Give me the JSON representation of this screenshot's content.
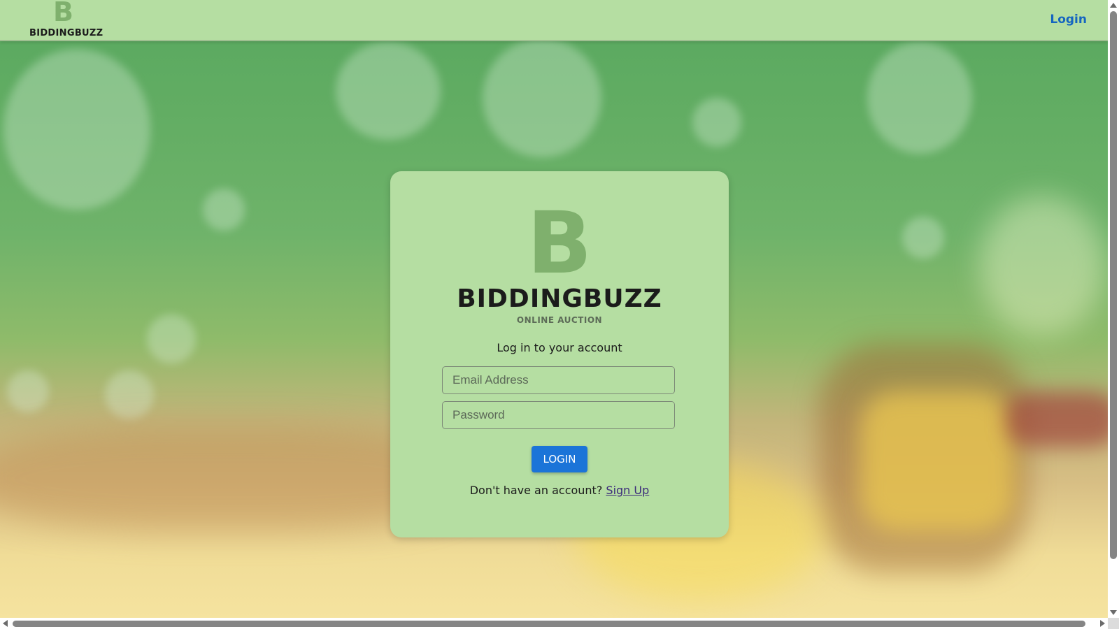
{
  "navbar": {
    "logo_letter": "B",
    "logo_wordmark": "BIDDINGBUZZ",
    "login_link": "Login"
  },
  "login_card": {
    "logo_letter": "B",
    "logo_wordmark": "BIDDINGBUZZ",
    "logo_tagline": "ONLINE AUCTION",
    "heading": "Log in to your account",
    "email_placeholder": "Email Address",
    "email_value": "",
    "password_placeholder": "Password",
    "password_value": "",
    "login_button": "LOGIN",
    "signup_prompt": "Don't have an account?",
    "signup_link": "Sign Up"
  },
  "colors": {
    "navbar_bg": "#b5dea2",
    "card_bg": "#b5dea2",
    "logo_green": "#7fb06d",
    "link_blue": "#1565c0",
    "button_blue": "#1b74d8",
    "signup_link": "#3b2a7a"
  },
  "icons": {
    "scroll_up": "arrow-up-icon",
    "scroll_down": "arrow-down-icon",
    "scroll_left": "arrow-left-icon",
    "scroll_right": "arrow-right-icon"
  }
}
